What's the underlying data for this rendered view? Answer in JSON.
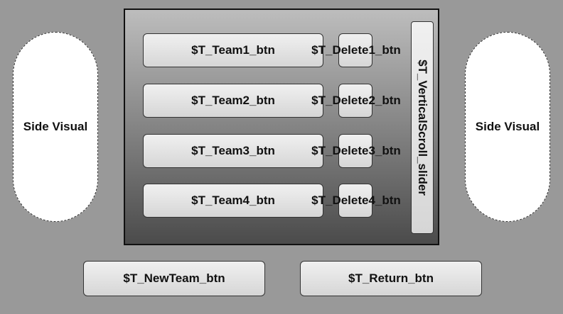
{
  "side_visuals": {
    "left_label": "Side Visual",
    "right_label": "Side Visual"
  },
  "team_panel": {
    "teams": [
      {
        "team_label": "$T_Team1_btn",
        "delete_label": "$T_Delete1_btn"
      },
      {
        "team_label": "$T_Team2_btn",
        "delete_label": "$T_Delete2_btn"
      },
      {
        "team_label": "$T_Team3_btn",
        "delete_label": "$T_Delete3_btn"
      },
      {
        "team_label": "$T_Team4_btn",
        "delete_label": "$T_Delete4_btn"
      }
    ],
    "scroll_slider_label": "$T_VerticalScroll_slider"
  },
  "bottom_bar": {
    "new_team_label": "$T_NewTeam_btn",
    "return_label": "$T_Return_btn"
  }
}
